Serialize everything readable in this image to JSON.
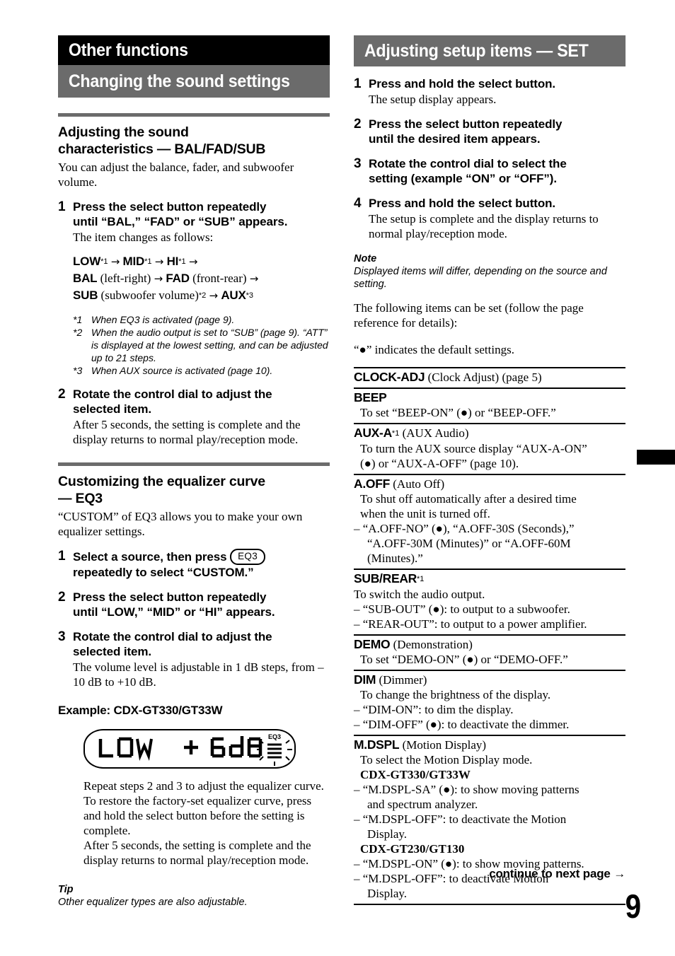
{
  "page_number": "9",
  "thumb_tab": {
    "present": true,
    "color": "#000000"
  },
  "colors": {
    "chapter_banner": "#000000",
    "section_banner": "#6b6b6b",
    "rule": "#6b6b6b",
    "text": "#000000"
  },
  "left": {
    "chapter_banner": "Other functions",
    "section_banner": "Changing the sound settings",
    "section1": {
      "heading_line1": "Adjusting the sound",
      "heading_line2": "characteristics — BAL/FAD/SUB",
      "intro": "You can adjust the balance, fader, and subwoofer volume.",
      "step1": {
        "num": "1",
        "title_line1": "Press the select button repeatedly",
        "title_line2": "until “BAL,” “FAD” or “SUB” appears.",
        "desc": "The item changes as follows:"
      },
      "flow": {
        "line1": {
          "a": "LOW",
          "a_fn": "*1",
          "b": "MID",
          "b_fn": "*1",
          "c": "HI",
          "c_fn": "*1"
        },
        "line2": {
          "a": "BAL",
          "a_paren": "(left-right)",
          "b": "FAD",
          "b_paren": "(front-rear)"
        },
        "line3": {
          "a": "SUB",
          "a_paren": "(subwoofer volume)",
          "a_fn": "*2",
          "b": "AUX",
          "b_fn": "*3"
        },
        "arrow": "→"
      },
      "footnotes": [
        {
          "mark": "*1",
          "text": "When EQ3 is activated (page 9)."
        },
        {
          "mark": "*2",
          "text": "When the audio output is set to “SUB” (page 9). “ATT” is displayed at the lowest setting, and can be adjusted up to 21 steps."
        },
        {
          "mark": "*3",
          "text": "When AUX source is activated (page 10)."
        }
      ],
      "step2": {
        "num": "2",
        "title_line1": "Rotate the control dial to adjust the",
        "title_line2": "selected item.",
        "desc": "After 5 seconds, the setting is complete and the display returns to normal play/reception mode."
      }
    },
    "section2": {
      "heading_line1": "Customizing the equalizer curve",
      "heading_line2": "— EQ3",
      "intro": "“CUSTOM” of EQ3 allows you to make your own equalizer settings.",
      "step1": {
        "num": "1",
        "title_pre": "Select a source, then press",
        "button_label": "EQ3",
        "title_line2": "repeatedly to select “CUSTOM.”"
      },
      "step2": {
        "num": "2",
        "title_line1": "Press the select button repeatedly",
        "title_line2": "until “LOW,” “MID” or “HI” appears."
      },
      "step3": {
        "num": "3",
        "title_line1": "Rotate the control dial to adjust the",
        "title_line2": "selected item.",
        "desc": "The volume level is adjustable in 1 dB steps, from –10 dB to +10 dB."
      },
      "example_caption": "Example: CDX-GT330/GT33W",
      "lcd": {
        "left_text": "LOW",
        "sign": "+",
        "value": "6dB",
        "indicator": "EQ3",
        "indicator_state": "flashing"
      },
      "after_lcd_para1": "Repeat steps 2 and 3 to adjust the equalizer curve.",
      "after_lcd_para2": "To restore the factory-set equalizer curve, press and hold the select button before the setting is complete.",
      "after_lcd_para3": "After 5 seconds, the setting is complete and the display returns to normal play/reception mode.",
      "tip_label": "Tip",
      "tip_text": "Other equalizer types are also adjustable."
    }
  },
  "right": {
    "section_banner": "Adjusting setup items — SET",
    "steps": [
      {
        "num": "1",
        "title_line1": "Press and hold the select button.",
        "title_line2": "",
        "desc": "The setup display appears."
      },
      {
        "num": "2",
        "title_line1": "Press the select button repeatedly",
        "title_line2": "until the desired item appears.",
        "desc": ""
      },
      {
        "num": "3",
        "title_line1": "Rotate the control dial to select the",
        "title_line2": "setting (example “ON” or “OFF”).",
        "desc": ""
      },
      {
        "num": "4",
        "title_line1": "Press and hold the select button.",
        "title_line2": "",
        "desc": "The setup is complete and the display returns to normal play/reception mode."
      }
    ],
    "note_label": "Note",
    "note_text": "Displayed items will differ, depending on the source and setting.",
    "intro_line1": "The following items can be set (follow the page reference for details):",
    "intro_line2": "“●” indicates the default settings.",
    "items": [
      {
        "name": "CLOCK-ADJ",
        "name_suffix": " (Clock Adjust) (page 5)",
        "lines": []
      },
      {
        "name": "BEEP",
        "name_suffix": "",
        "lines": [
          {
            "style": "indent",
            "text": "To set “BEEP-ON” (●) or “BEEP-OFF.”"
          }
        ]
      },
      {
        "name": "AUX-A",
        "name_fn": "*1",
        "name_suffix": " (AUX Audio)",
        "lines": [
          {
            "style": "indent",
            "text": "To turn the AUX source display “AUX-A-ON”"
          },
          {
            "style": "indent",
            "text": "(●) or “AUX-A-OFF” (page 10)."
          }
        ]
      },
      {
        "name": "A.OFF",
        "name_suffix": " (Auto Off)",
        "lines": [
          {
            "style": "indent",
            "text": "To shut off automatically after a desired time"
          },
          {
            "style": "indent",
            "text": "when the unit is turned off."
          },
          {
            "style": "dash",
            "text": "– “A.OFF-NO” (●), “A.OFF-30S (Seconds),”"
          },
          {
            "style": "dash-cont",
            "text": "“A.OFF-30M (Minutes)” or “A.OFF-60M"
          },
          {
            "style": "dash-cont",
            "text": "(Minutes).”"
          }
        ]
      },
      {
        "name": "SUB/REAR",
        "name_fn": "*1",
        "name_suffix": "",
        "lines": [
          {
            "style": "noindent",
            "text": "To switch the audio output."
          },
          {
            "style": "dash",
            "text": "– “SUB-OUT” (●): to output to a subwoofer."
          },
          {
            "style": "dash",
            "text": "– “REAR-OUT”: to output to a power amplifier."
          }
        ]
      },
      {
        "name": "DEMO",
        "name_suffix": " (Demonstration)",
        "lines": [
          {
            "style": "indent",
            "text": "To set “DEMO-ON” (●) or “DEMO-OFF.”"
          }
        ]
      },
      {
        "name": "DIM",
        "name_suffix": " (Dimmer)",
        "lines": [
          {
            "style": "indent",
            "text": "To change the brightness of the display."
          },
          {
            "style": "dash",
            "text": "– “DIM-ON”: to dim the display."
          },
          {
            "style": "dash",
            "text": "– “DIM-OFF” (●): to deactivate the dimmer."
          }
        ]
      },
      {
        "name": "M.DSPL",
        "name_suffix": " (Motion Display)",
        "lines": [
          {
            "style": "indent",
            "text": "To select the Motion Display mode."
          },
          {
            "style": "model",
            "text": "CDX-GT330/GT33W"
          },
          {
            "style": "dash",
            "text": "– “M.DSPL-SA” (●): to show moving patterns"
          },
          {
            "style": "dash-cont",
            "text": "and spectrum analyzer."
          },
          {
            "style": "dash",
            "text": "– “M.DSPL-OFF”: to deactivate the Motion"
          },
          {
            "style": "dash-cont",
            "text": "Display."
          },
          {
            "style": "model",
            "text": "CDX-GT230/GT130"
          },
          {
            "style": "dash",
            "text": "– “M.DSPL-ON” (●): to show moving patterns."
          },
          {
            "style": "dash",
            "text": "– “M.DSPL-OFF”: to deactivate Motion"
          },
          {
            "style": "dash-cont",
            "text": "Display."
          }
        ]
      }
    ],
    "footer_note": "continue to next page →"
  }
}
